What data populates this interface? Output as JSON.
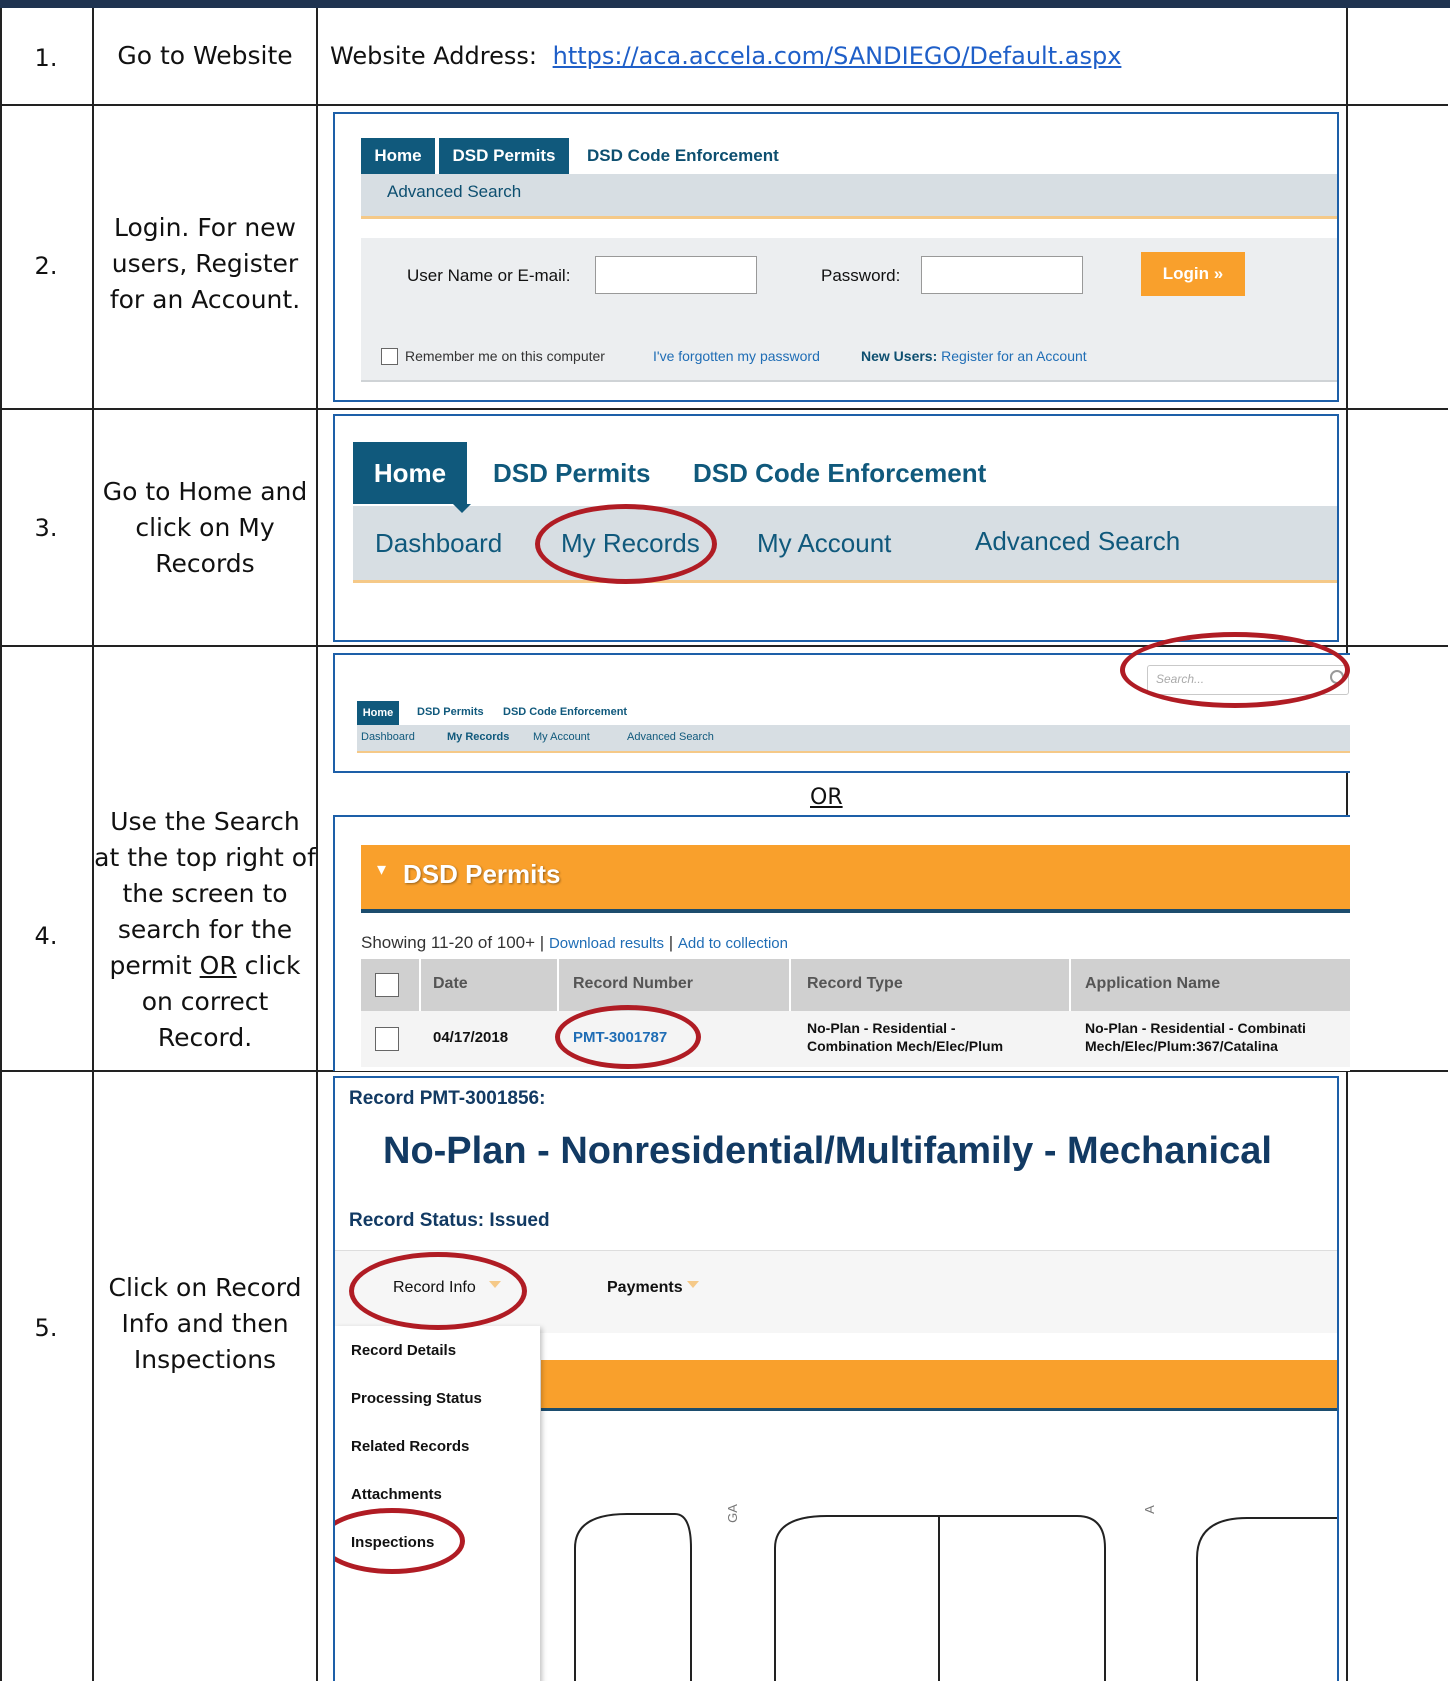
{
  "step1": {
    "number": "1.",
    "instruction": "Go to Website",
    "address_label": "Website Address:",
    "address_url": "https://aca.accela.com/SANDIEGO/Default.aspx"
  },
  "step2": {
    "number": "2.",
    "instruction": "Login.  For new users, Register for an Account.",
    "tabs": [
      "Home",
      "DSD Permits",
      "DSD Code Enforcement"
    ],
    "subnav": "Advanced Search",
    "username_label": "User Name or E-mail:",
    "password_label": "Password:",
    "login_button": "Login »",
    "remember": "Remember me on this computer",
    "forgot": "I've forgotten my password",
    "new_users_label": "New Users:",
    "register": "Register for an Account"
  },
  "step3": {
    "number": "3.",
    "instruction": "Go to Home and click on My Records",
    "tabs": [
      "Home",
      "DSD Permits",
      "DSD Code Enforcement"
    ],
    "subnav": [
      "Dashboard",
      "My Records",
      "My Account",
      "Advanced Search"
    ]
  },
  "step4": {
    "number": "4.",
    "instruction_a": "Use the Search at the top right of the screen to search for the permit",
    "instruction_or": "OR",
    "instruction_b": "click on correct Record.",
    "search_placeholder": "Search...",
    "tabs": [
      "Home",
      "DSD Permits",
      "DSD Code Enforcement"
    ],
    "subnav": [
      "Dashboard",
      "My Records",
      "My Account",
      "Advanced Search"
    ],
    "or_label": "OR",
    "section_title": "DSD Permits",
    "showing": "Showing 11-20 of 100+ |",
    "download": "Download results",
    "sep": "|",
    "add_collection": "Add to collection",
    "columns": [
      "Date",
      "Record Number",
      "Record Type",
      "Application Name"
    ],
    "row": {
      "date": "04/17/2018",
      "record_number": "PMT-3001787",
      "record_type_line1": "No-Plan - Residential -",
      "record_type_line2": "Combination Mech/Elec/Plum",
      "app_name_line1": "No-Plan - Residential - Combinati",
      "app_name_line2": "Mech/Elec/Plum:367/Catalina"
    }
  },
  "step5": {
    "number": "5.",
    "instruction": "Click on Record Info and then Inspections",
    "record_label": "Record PMT-3001856:",
    "record_title": "No-Plan - Nonresidential/Multifamily - Mechanical",
    "status": "Record Status: Issued",
    "menu": [
      "Record Info",
      "Payments"
    ],
    "dropdown": [
      "Record Details",
      "Processing Status",
      "Related Records",
      "Attachments",
      "Inspections"
    ],
    "map_letters": [
      "GA",
      "A"
    ]
  },
  "colors": {
    "tab_blue": "#10597c",
    "orange": "#f9a02c",
    "annotation_red": "#b01c24",
    "frame_blue": "#1d5fa8"
  }
}
